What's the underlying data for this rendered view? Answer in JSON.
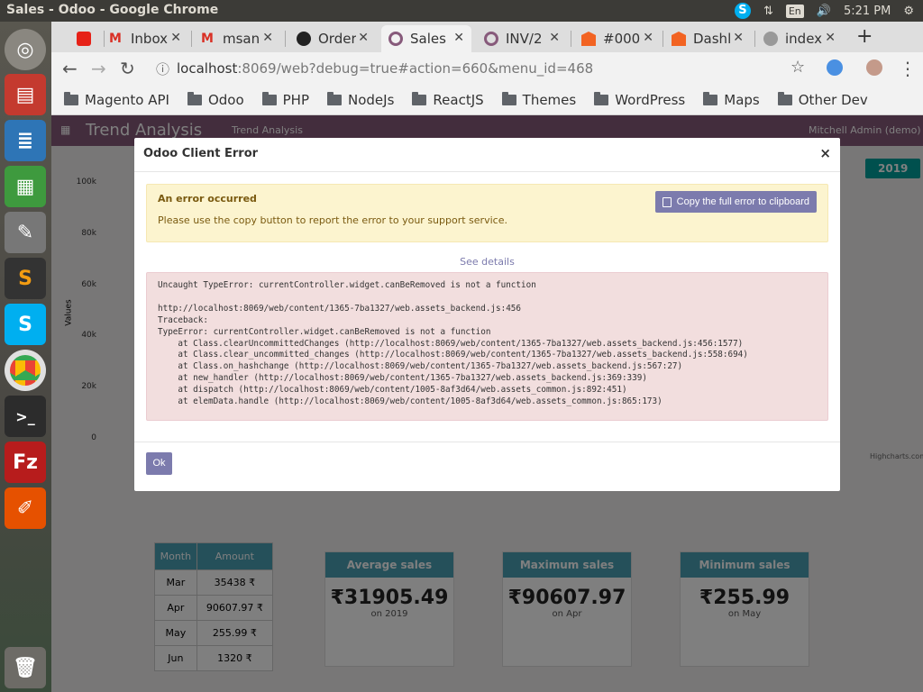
{
  "window": {
    "title": "Sales - Odoo - Google Chrome",
    "lang": "En",
    "time": "5:21 PM"
  },
  "launcher": {
    "apps": [
      "ubuntu-dash",
      "file-manager",
      "libreoffice-writer",
      "libreoffice-calc",
      "system-settings",
      "sublime-text",
      "skype",
      "google-chrome",
      "terminal",
      "filezilla",
      "text-editor",
      "trash"
    ]
  },
  "tabs": [
    {
      "label": "",
      "icon": "youtube-icon"
    },
    {
      "label": "Inbox",
      "icon": "gmail-icon"
    },
    {
      "label": "msan",
      "icon": "gmail-icon"
    },
    {
      "label": "Order",
      "icon": "github-icon"
    },
    {
      "label": "Sales",
      "icon": "odoo-icon",
      "active": true
    },
    {
      "label": "INV/2",
      "icon": "odoo-icon"
    },
    {
      "label": "#000",
      "icon": "magento-icon"
    },
    {
      "label": "Dashl",
      "icon": "magento-icon"
    },
    {
      "label": "index",
      "icon": "globe-icon"
    }
  ],
  "address": {
    "host": "localhost",
    "rest": ":8069/web?debug=true#action=660&menu_id=468"
  },
  "bookmarks": [
    "Magento API",
    "Odoo",
    "PHP",
    "NodeJs",
    "ReactJS",
    "Themes",
    "WordPress",
    "Maps",
    "Other Dev"
  ],
  "odoo": {
    "app_title": "Trend Analysis",
    "menu": "Trend Analysis",
    "user": "Mitchell Admin (demo)",
    "year_button": "2019",
    "chart_y_label": "Values",
    "chart_y_ticks": [
      "100k",
      "80k",
      "60k",
      "40k",
      "20k",
      "0"
    ],
    "credit": "Highcharts.com",
    "table": {
      "headers": [
        "Month",
        "Amount"
      ],
      "rows": [
        [
          "Mar",
          "35438 ₹"
        ],
        [
          "Apr",
          "90607.97 ₹"
        ],
        [
          "May",
          "255.99 ₹"
        ],
        [
          "Jun",
          "1320 ₹"
        ]
      ]
    },
    "cards": [
      {
        "title": "Average sales",
        "value": "₹31905.49",
        "sub": "on 2019"
      },
      {
        "title": "Maximum sales",
        "value": "₹90607.97",
        "sub": "on Apr"
      },
      {
        "title": "Minimum sales",
        "value": "₹255.99",
        "sub": "on May"
      }
    ]
  },
  "dialog": {
    "title": "Odoo Client Error",
    "close": "×",
    "alert_title": "An error occurred",
    "alert_msg": "Please use the copy button to report the error to your support service.",
    "copy_button": "Copy the full error to clipboard",
    "see_details": "See details",
    "error_text": "Uncaught TypeError: currentController.widget.canBeRemoved is not a function\n\nhttp://localhost:8069/web/content/1365-7ba1327/web.assets_backend.js:456\nTraceback:\nTypeError: currentController.widget.canBeRemoved is not a function\n    at Class.clearUncommittedChanges (http://localhost:8069/web/content/1365-7ba1327/web.assets_backend.js:456:1577)\n    at Class.clear_uncommitted_changes (http://localhost:8069/web/content/1365-7ba1327/web.assets_backend.js:558:694)\n    at Class.on_hashchange (http://localhost:8069/web/content/1365-7ba1327/web.assets_backend.js:567:27)\n    at new_handler (http://localhost:8069/web/content/1365-7ba1327/web.assets_backend.js:369:339)\n    at dispatch (http://localhost:8069/web/content/1005-8af3d64/web.assets_common.js:892:451)\n    at elemData.handle (http://localhost:8069/web/content/1005-8af3d64/web.assets_common.js:865:173)",
    "ok_button": "Ok"
  },
  "colors": {
    "odoo_purple": "#875a7b",
    "button_purple": "#7c7bad",
    "alert_bg": "#fcf4cf",
    "error_bg": "#f2dede"
  }
}
